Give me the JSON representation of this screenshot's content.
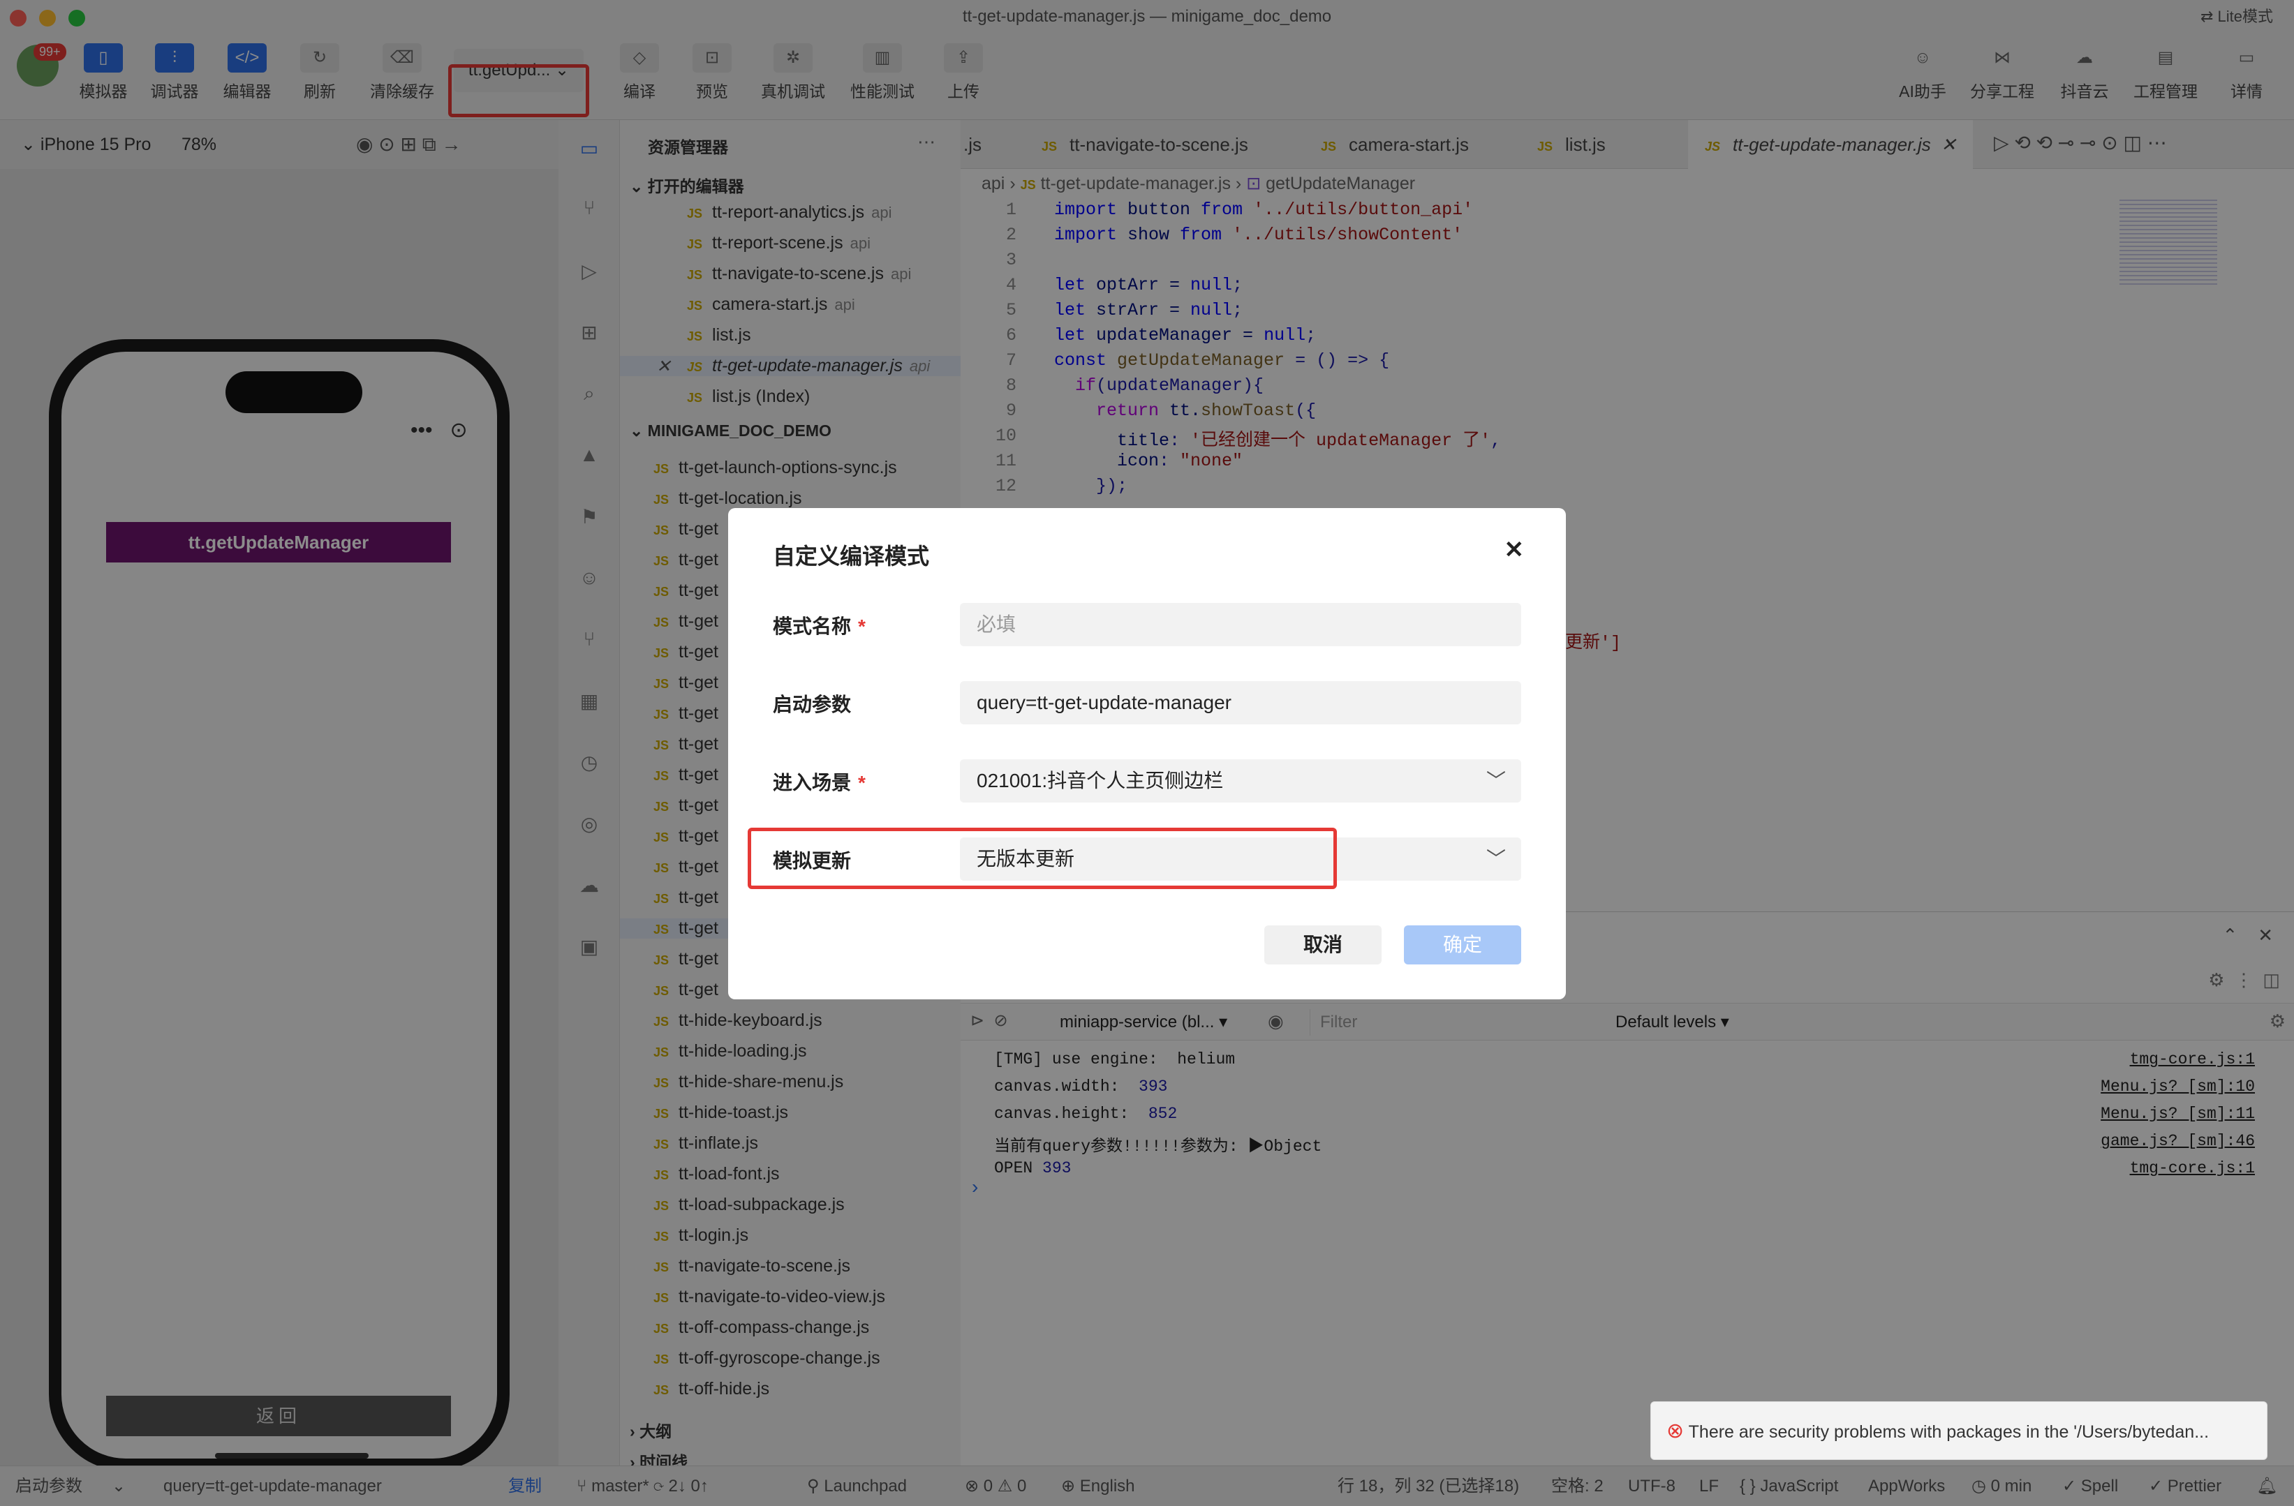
{
  "window": {
    "title": "tt-get-update-manager.js — minigame_doc_demo",
    "mode_label": "Lite模式"
  },
  "toolbar": {
    "avatar_badge": "99+",
    "simulator": "模拟器",
    "debugger": "调试器",
    "editor": "编辑器",
    "refresh": "刷新",
    "clear_cache": "清除缓存",
    "compile_mode": "tt.getUpd...",
    "compile": "编译",
    "preview": "预览",
    "real_debug": "真机调试",
    "perf_test": "性能测试",
    "upload": "上传",
    "ai_helper": "AI助手",
    "share": "分享工程",
    "cloud": "抖音云",
    "project_mgmt": "工程管理",
    "details": "详情"
  },
  "simulator": {
    "device": "iPhone 15 Pro",
    "zoom": "78%",
    "more_dots": "•••",
    "main_button": "tt.getUpdateManager",
    "back_button": "返回"
  },
  "explorer": {
    "title": "资源管理器",
    "open_editors_title": "打开的编辑器",
    "open_editors": [
      {
        "name": "tt-report-analytics.js",
        "dir": "api"
      },
      {
        "name": "tt-report-scene.js",
        "dir": "api"
      },
      {
        "name": "tt-navigate-to-scene.js",
        "dir": "api"
      },
      {
        "name": "camera-start.js",
        "dir": "api"
      },
      {
        "name": "list.js",
        "dir": ""
      },
      {
        "name": "tt-get-update-manager.js",
        "dir": "api"
      },
      {
        "name": "list.js (Index)",
        "dir": ""
      }
    ],
    "project_title": "MINIGAME_DOC_DEMO",
    "files": [
      "tt-get-launch-options-sync.js",
      "tt-get-location.js",
      "tt-get",
      "tt-get",
      "tt-get",
      "tt-get",
      "tt-get",
      "tt-get",
      "tt-get",
      "tt-get",
      "tt-get",
      "tt-get",
      "tt-get",
      "tt-get",
      "tt-get",
      "tt-get",
      "tt-get",
      "tt-get",
      "tt-hide-keyboard.js",
      "tt-hide-loading.js",
      "tt-hide-share-menu.js",
      "tt-hide-toast.js",
      "tt-inflate.js",
      "tt-load-font.js",
      "tt-load-subpackage.js",
      "tt-login.js",
      "tt-navigate-to-scene.js",
      "tt-navigate-to-video-view.js",
      "tt-off-compass-change.js",
      "tt-off-gyroscope-change.js",
      "tt-off-hide.js"
    ],
    "outline": "大纲",
    "timeline": "时间线"
  },
  "editor": {
    "tabs": [
      ".js",
      "tt-navigate-to-scene.js",
      "camera-start.js",
      "list.js",
      "tt-get-update-manager.js"
    ],
    "breadcrumb": [
      "api",
      "tt-get-update-manager.js",
      "getUpdateManager"
    ],
    "lines": [
      "1",
      "2",
      "3",
      "4",
      "5",
      "6",
      "7",
      "8",
      "9",
      "10",
      "11",
      "12"
    ],
    "code": {
      "l1a": "import",
      "l1b": " button ",
      "l1c": "from",
      "l1d": " '../utils/button_api'",
      "l2a": "import",
      "l2b": " show ",
      "l2c": "from",
      "l2d": " '../utils/showContent'",
      "l4a": "let",
      "l4b": " optArr = ",
      "l4c": "null",
      "l4d": ";",
      "l5a": "let",
      "l5b": " strArr = ",
      "l5c": "null",
      "l5d": ";",
      "l6a": "let",
      "l6b": " updateManager = ",
      "l6c": "null",
      "l6d": ";",
      "l7a": "const",
      "l7b": " getUpdateManager",
      "l7c": " = () => {",
      "l8a": "  if",
      "l8b": "(updateManager){",
      "l9a": "    return",
      "l9b": " tt.",
      "l9c": "showToast",
      "l9d": "({",
      "l10a": "      title",
      "l10b": ": ",
      "l10c": "'已经创建一个 updateManager 了'",
      "l10d": ",",
      "l11a": "      icon",
      "l11b": ": ",
      "l11c": "\"none\"",
      "l12": "    });",
      "fragment": "更新']"
    }
  },
  "console": {
    "context": "miniapp-service (bl...",
    "filter_placeholder": "Filter",
    "levels": "Default levels",
    "logs": [
      {
        "pre": "[TMG] use engine:  helium",
        "num": "",
        "src": "tmg-core.js:1"
      },
      {
        "pre": "canvas.width:  ",
        "num": "393",
        "src": "Menu.js? [sm]:10"
      },
      {
        "pre": "canvas.height:  ",
        "num": "852",
        "src": "Menu.js? [sm]:11"
      },
      {
        "pre": "当前有query参数!!!!!!参数为: ▶Object",
        "num": "",
        "src": "game.js? [sm]:46"
      },
      {
        "pre": "OPEN ",
        "num": "393",
        "src": "tmg-core.js:1"
      }
    ],
    "prompt": "›"
  },
  "modal": {
    "title": "自定义编译模式",
    "close": "✕",
    "name_label": "模式名称",
    "name_placeholder": "必填",
    "params_label": "启动参数",
    "params_value": "query=tt-get-update-manager",
    "scene_label": "进入场景",
    "scene_value": "021001:抖音个人主页侧边栏",
    "update_label": "模拟更新",
    "update_value": "无版本更新",
    "required_mark": "*",
    "cancel": "取消",
    "confirm": "确定"
  },
  "toast": {
    "text": "There are security problems with packages in the '/Users/bytedan..."
  },
  "statusbar": {
    "launch_label": "启动参数",
    "launch_value": "query=tt-get-update-manager",
    "copy": "复制",
    "branch": "master*",
    "sync": "2↓ 0↑",
    "launchpad": "Launchpad",
    "problems": "⊗ 0 ⚠ 0",
    "language": "English",
    "cursor": "行 18，列 32 (已选择18)",
    "spaces": "空格: 2",
    "encoding": "UTF-8",
    "eol": "LF",
    "lang_mode": "{ } JavaScript",
    "appworks": "AppWorks",
    "time": "0 min",
    "spell": "Spell",
    "prettier": "Prettier"
  },
  "colors": {
    "accent": "#2f6fe8",
    "highlight": "#e53935",
    "button_purple": "#6d156d",
    "confirm_disabled": "#a8c8f8"
  }
}
